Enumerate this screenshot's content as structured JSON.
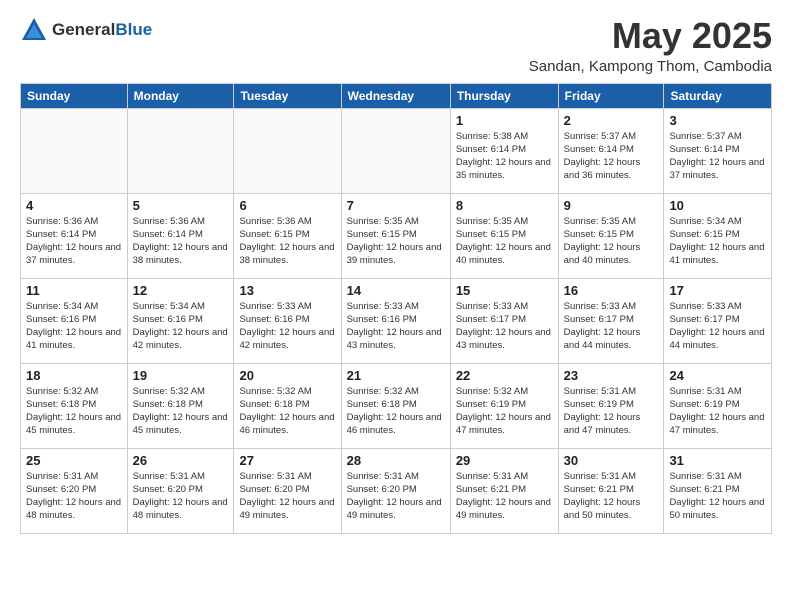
{
  "logo": {
    "general": "General",
    "blue": "Blue"
  },
  "header": {
    "title": "May 2025",
    "subtitle": "Sandan, Kampong Thom, Cambodia"
  },
  "weekdays": [
    "Sunday",
    "Monday",
    "Tuesday",
    "Wednesday",
    "Thursday",
    "Friday",
    "Saturday"
  ],
  "weeks": [
    [
      {
        "day": "",
        "info": ""
      },
      {
        "day": "",
        "info": ""
      },
      {
        "day": "",
        "info": ""
      },
      {
        "day": "",
        "info": ""
      },
      {
        "day": "1",
        "info": "Sunrise: 5:38 AM\nSunset: 6:14 PM\nDaylight: 12 hours\nand 35 minutes."
      },
      {
        "day": "2",
        "info": "Sunrise: 5:37 AM\nSunset: 6:14 PM\nDaylight: 12 hours\nand 36 minutes."
      },
      {
        "day": "3",
        "info": "Sunrise: 5:37 AM\nSunset: 6:14 PM\nDaylight: 12 hours\nand 37 minutes."
      }
    ],
    [
      {
        "day": "4",
        "info": "Sunrise: 5:36 AM\nSunset: 6:14 PM\nDaylight: 12 hours\nand 37 minutes."
      },
      {
        "day": "5",
        "info": "Sunrise: 5:36 AM\nSunset: 6:14 PM\nDaylight: 12 hours\nand 38 minutes."
      },
      {
        "day": "6",
        "info": "Sunrise: 5:36 AM\nSunset: 6:15 PM\nDaylight: 12 hours\nand 38 minutes."
      },
      {
        "day": "7",
        "info": "Sunrise: 5:35 AM\nSunset: 6:15 PM\nDaylight: 12 hours\nand 39 minutes."
      },
      {
        "day": "8",
        "info": "Sunrise: 5:35 AM\nSunset: 6:15 PM\nDaylight: 12 hours\nand 40 minutes."
      },
      {
        "day": "9",
        "info": "Sunrise: 5:35 AM\nSunset: 6:15 PM\nDaylight: 12 hours\nand 40 minutes."
      },
      {
        "day": "10",
        "info": "Sunrise: 5:34 AM\nSunset: 6:15 PM\nDaylight: 12 hours\nand 41 minutes."
      }
    ],
    [
      {
        "day": "11",
        "info": "Sunrise: 5:34 AM\nSunset: 6:16 PM\nDaylight: 12 hours\nand 41 minutes."
      },
      {
        "day": "12",
        "info": "Sunrise: 5:34 AM\nSunset: 6:16 PM\nDaylight: 12 hours\nand 42 minutes."
      },
      {
        "day": "13",
        "info": "Sunrise: 5:33 AM\nSunset: 6:16 PM\nDaylight: 12 hours\nand 42 minutes."
      },
      {
        "day": "14",
        "info": "Sunrise: 5:33 AM\nSunset: 6:16 PM\nDaylight: 12 hours\nand 43 minutes."
      },
      {
        "day": "15",
        "info": "Sunrise: 5:33 AM\nSunset: 6:17 PM\nDaylight: 12 hours\nand 43 minutes."
      },
      {
        "day": "16",
        "info": "Sunrise: 5:33 AM\nSunset: 6:17 PM\nDaylight: 12 hours\nand 44 minutes."
      },
      {
        "day": "17",
        "info": "Sunrise: 5:33 AM\nSunset: 6:17 PM\nDaylight: 12 hours\nand 44 minutes."
      }
    ],
    [
      {
        "day": "18",
        "info": "Sunrise: 5:32 AM\nSunset: 6:18 PM\nDaylight: 12 hours\nand 45 minutes."
      },
      {
        "day": "19",
        "info": "Sunrise: 5:32 AM\nSunset: 6:18 PM\nDaylight: 12 hours\nand 45 minutes."
      },
      {
        "day": "20",
        "info": "Sunrise: 5:32 AM\nSunset: 6:18 PM\nDaylight: 12 hours\nand 46 minutes."
      },
      {
        "day": "21",
        "info": "Sunrise: 5:32 AM\nSunset: 6:18 PM\nDaylight: 12 hours\nand 46 minutes."
      },
      {
        "day": "22",
        "info": "Sunrise: 5:32 AM\nSunset: 6:19 PM\nDaylight: 12 hours\nand 47 minutes."
      },
      {
        "day": "23",
        "info": "Sunrise: 5:31 AM\nSunset: 6:19 PM\nDaylight: 12 hours\nand 47 minutes."
      },
      {
        "day": "24",
        "info": "Sunrise: 5:31 AM\nSunset: 6:19 PM\nDaylight: 12 hours\nand 47 minutes."
      }
    ],
    [
      {
        "day": "25",
        "info": "Sunrise: 5:31 AM\nSunset: 6:20 PM\nDaylight: 12 hours\nand 48 minutes."
      },
      {
        "day": "26",
        "info": "Sunrise: 5:31 AM\nSunset: 6:20 PM\nDaylight: 12 hours\nand 48 minutes."
      },
      {
        "day": "27",
        "info": "Sunrise: 5:31 AM\nSunset: 6:20 PM\nDaylight: 12 hours\nand 49 minutes."
      },
      {
        "day": "28",
        "info": "Sunrise: 5:31 AM\nSunset: 6:20 PM\nDaylight: 12 hours\nand 49 minutes."
      },
      {
        "day": "29",
        "info": "Sunrise: 5:31 AM\nSunset: 6:21 PM\nDaylight: 12 hours\nand 49 minutes."
      },
      {
        "day": "30",
        "info": "Sunrise: 5:31 AM\nSunset: 6:21 PM\nDaylight: 12 hours\nand 50 minutes."
      },
      {
        "day": "31",
        "info": "Sunrise: 5:31 AM\nSunset: 6:21 PM\nDaylight: 12 hours\nand 50 minutes."
      }
    ]
  ]
}
